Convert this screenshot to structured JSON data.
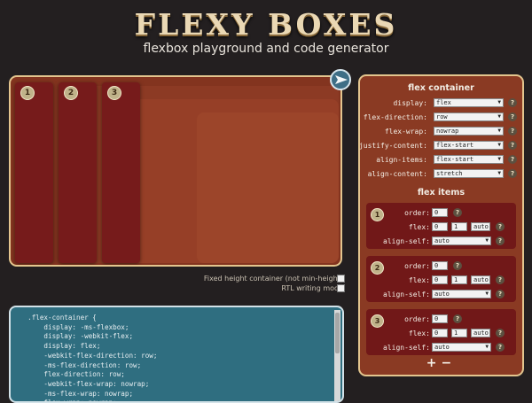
{
  "header": {
    "logo": "FLEXY BOXES",
    "tagline": "flexbox playground and code generator"
  },
  "playground": {
    "items": [
      "1",
      "2",
      "3"
    ],
    "play_label": "run"
  },
  "options": {
    "fixed_height": "Fixed height container (not min-height)",
    "rtl": "RTL writing mode",
    "fixed_height_checked": true,
    "rtl_checked": false
  },
  "code": "  .flex-container {\n      display: -ms-flexbox;\n      display: -webkit-flex;\n      display: flex;\n      -webkit-flex-direction: row;\n      -ms-flex-direction: row;\n      flex-direction: row;\n      -webkit-flex-wrap: nowrap;\n      -ms-flex-wrap: nowrap;\n      flex-wrap: nowrap;",
  "container": {
    "heading": "flex container",
    "props": [
      {
        "label": "display:",
        "value": "flex"
      },
      {
        "label": "flex-direction:",
        "value": "row"
      },
      {
        "label": "flex-wrap:",
        "value": "nowrap"
      },
      {
        "label": "justify-content:",
        "value": "flex-start"
      },
      {
        "label": "align-items:",
        "value": "flex-start"
      },
      {
        "label": "align-content:",
        "value": "stretch"
      }
    ]
  },
  "items": {
    "heading": "flex items",
    "list": [
      {
        "num": "1",
        "order": "0",
        "flex_grow": "0",
        "flex_shrink": "1",
        "flex_basis": "auto",
        "align_self": "auto"
      },
      {
        "num": "2",
        "order": "0",
        "flex_grow": "0",
        "flex_shrink": "1",
        "flex_basis": "auto",
        "align_self": "auto"
      },
      {
        "num": "3",
        "order": "0",
        "flex_grow": "0",
        "flex_shrink": "1",
        "flex_basis": "auto",
        "align_self": "auto"
      }
    ],
    "order_label": "order:",
    "flex_label": "flex:",
    "align_label": "align-self:",
    "help": "?",
    "arrow": "▼",
    "add": "+",
    "remove": "−"
  },
  "colors": {
    "background": "#231f20",
    "panel": "#8a3a23",
    "item": "#761b1b",
    "accent": "#e3c58e",
    "code_bg": "#2f6e80"
  },
  "icons": {
    "play": "play-icon",
    "help": "help-icon",
    "dropdown": "chevron-down-icon"
  }
}
